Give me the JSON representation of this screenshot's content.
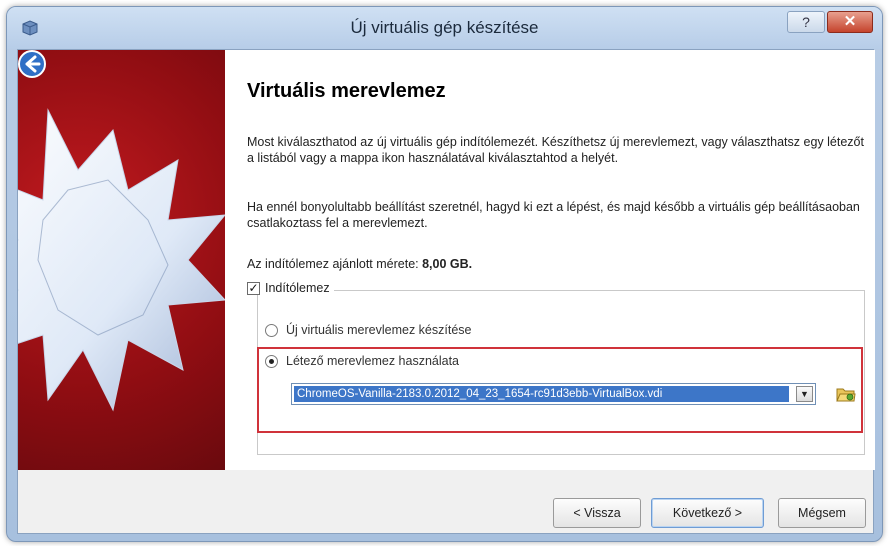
{
  "window": {
    "title": "Új virtuális gép készítése",
    "help_label": "?",
    "close_label": "✕"
  },
  "wizard": {
    "heading": "Virtuális merevlemez",
    "paragraph1": "Most kiválaszthatod az új virtuális gép indítólemezét. Készíthetsz új merevlemezt, vagy választhatsz egy létezőt a listából vagy a mappa ikon használatával kiválasztahtod a helyét.",
    "paragraph2": "Ha ennél bonyolultabb beállítást szeretnél, hagyd ki ezt a lépést, és majd később a virtuális gép beállításaoban csatlakoztass fel a merevlemezt.",
    "recommended_prefix": "Az indítólemez ajánlott mérete:",
    "recommended_size": "8,00 GB."
  },
  "boot_disk": {
    "checkbox_label": "Indítólemez",
    "checked": true,
    "option_new": "Új virtuális merevlemez készítése",
    "option_existing": "Létező merevlemez használata",
    "selected_option": "existing",
    "selected_file": "ChromeOS-Vanilla-2183.0.2012_04_23_1654-rc91d3ebb-VirtualBox.vdi"
  },
  "buttons": {
    "back": "< Vissza",
    "next": "Következő >",
    "cancel": "Mégsem"
  },
  "colors": {
    "highlight_border": "#d0323a",
    "selection": "#3d76c8",
    "side_panel": "#8f0d12"
  }
}
